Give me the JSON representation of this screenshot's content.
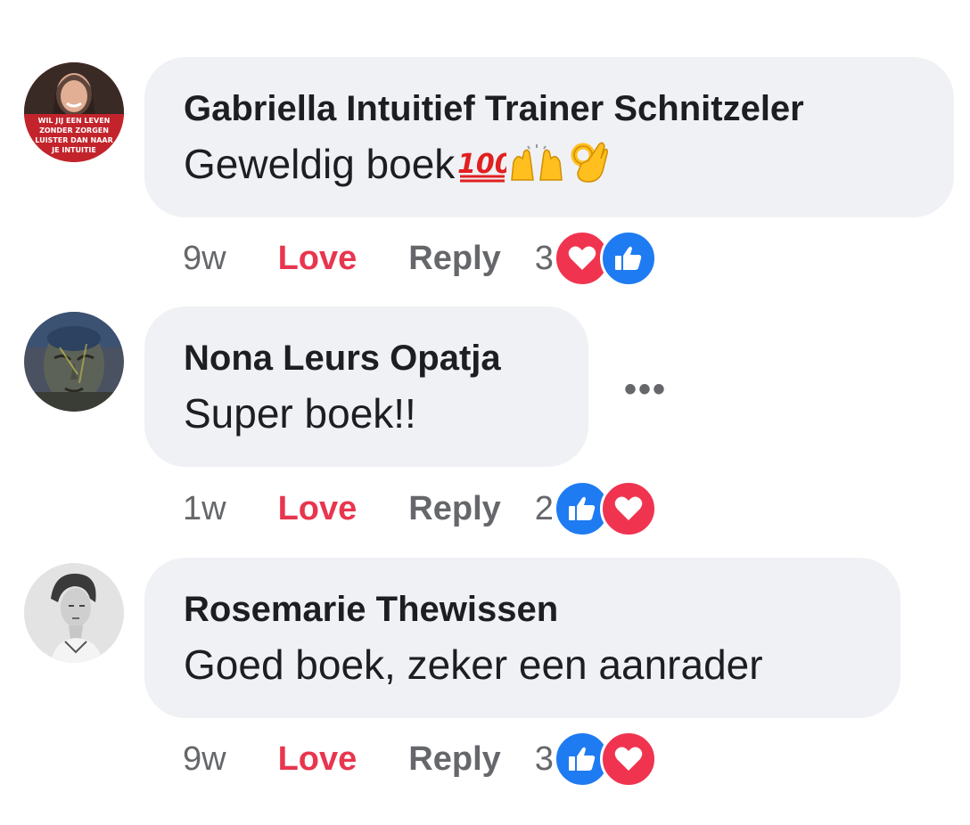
{
  "comments": [
    {
      "author": "Gabriella Intuitief Trainer Schnitzeler",
      "text": "Geweldig boek",
      "emojis": [
        "hundred-points-emoji",
        "raising-hands-emoji",
        "ok-hand-emoji"
      ],
      "time": "9w",
      "love_label": "Love",
      "reply_label": "Reply",
      "reaction_count": "3",
      "reactions": [
        "heart-reaction",
        "like-reaction"
      ],
      "avatar_text": [
        "WIL JIJ EEN LEVEN",
        "ZONDER ZORGEN",
        "LUISTER DAN NAAR",
        "JE INTUITIE"
      ]
    },
    {
      "author": "Nona Leurs Opatja",
      "text": "Super boek!!",
      "time": "1w",
      "love_label": "Love",
      "reply_label": "Reply",
      "reaction_count": "2",
      "reactions": [
        "like-reaction",
        "heart-reaction"
      ],
      "more_label": "•••"
    },
    {
      "author": "Rosemarie Thewissen",
      "text": "Goed boek, zeker een aanrader",
      "time": "9w",
      "love_label": "Love",
      "reply_label": "Reply",
      "reaction_count": "3",
      "reactions": [
        "like-reaction",
        "heart-reaction"
      ]
    }
  ],
  "colors": {
    "bubble": "#f0f1f4",
    "love": "#e8364f",
    "muted": "#65676b",
    "like": "#1e7bf2",
    "heart": "#f0344f"
  }
}
